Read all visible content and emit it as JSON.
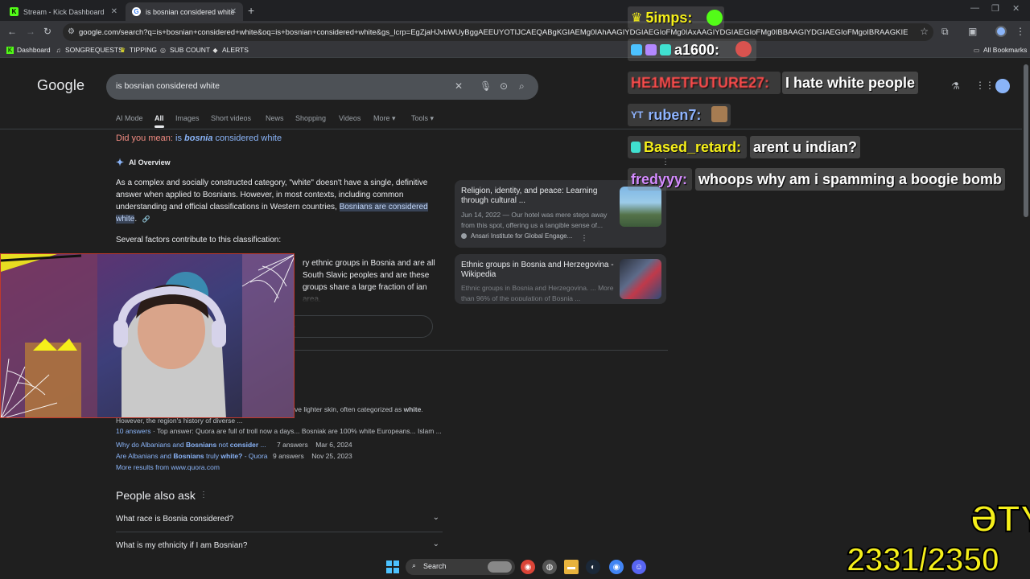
{
  "browser": {
    "tabs": [
      {
        "title": "Stream - Kick Dashboard",
        "favicon": "kick-icon",
        "active": false
      },
      {
        "title": "is bosnian considered white - G",
        "favicon": "google-icon",
        "active": true
      }
    ],
    "new_tab": "+",
    "url": "google.com/search?q=is+bosnian+considered+white&oq=is+bosnian+considered+white&gs_lcrp=EgZjaHJvbWUyBggAEEUYOTIJCAEQABgKGIAEMg0IAhAAGIYDGIAEGIoFMg0IAxAAGIYDGIAEGIoFMg0IBBAAGIYDGIAEGIoFMgoIBRAAGKIEGIkF0gEIMzMyNmowajeoAg..."
  },
  "bookmarks": [
    {
      "label": "Dashboard",
      "icon": "kick-icon"
    },
    {
      "label": "SONGREQUESTS",
      "icon": "music-icon"
    },
    {
      "label": "TIPPING",
      "icon": "tip-icon"
    },
    {
      "label": "SUB COUNT",
      "icon": "sub-icon"
    },
    {
      "label": "ALERTS",
      "icon": "alert-icon"
    }
  ],
  "all_bookmarks": "All Bookmarks",
  "google": {
    "logo": "Google",
    "query": "is bosnian considered white",
    "tabs": [
      "AI Mode",
      "All",
      "Images",
      "Short videos",
      "News",
      "Shopping",
      "Videos",
      "More",
      "Tools"
    ],
    "did_you_mean_label": "Did you mean:",
    "did_you_mean_pre": "is",
    "did_you_mean_bold": "bosnia",
    "did_you_mean_post": "considered white",
    "ai_overview_title": "AI Overview",
    "aio_text": "As a complex and socially constructed category, \"white\" doesn't have a single, definitive answer when applied to Bosnians. However, in most contexts, including common understanding and official classifications in Western countries,",
    "aio_highlight": "Bosnians are considered white",
    "aio_p2": "Several factors contribute to this classification:",
    "aio_p3": "ry ethnic groups in Bosnia and are all South Slavic peoples and are these groups share a large fraction of ian area.",
    "sources": [
      {
        "title": "Religion, identity, and peace: Learning through cultural ...",
        "desc": "Jun 14, 2022 — Our hotel was mere steps away from this spot, offering us a tangible sense of...",
        "site": "Ansari Institute for Global Engage..."
      },
      {
        "title": "Ethnic groups in Bosnia and Herzegovina - Wikipedia",
        "desc": "Ethnic groups in Bosnia and Herzegovina. ... More than 96% of the population of Bosnia ...",
        "site": ""
      }
    ],
    "quora": {
      "snippet1": "ve lighter skin, often categorized as",
      "snippet1_bold": "white",
      "snippet2": "However, the region's history of diverse ...",
      "answers_count": "10 answers",
      "answers_text": " · Top answer: Quora are full of troll now a days... Bosniak are 100% white Europeans... Islam ...",
      "links": [
        {
          "pre": "Why do Albanians and ",
          "bold": "Bosnians",
          "mid": " not ",
          "bold2": "consider",
          "post": " ...",
          "answers": "7 answers",
          "date": "Mar 6, 2024"
        },
        {
          "pre": "Are Albanians and ",
          "bold": "Bosnians",
          "mid": " truly ",
          "bold2": "white?",
          "post": " - Quora",
          "answers": "9 answers",
          "date": "Nov 25, 2023"
        }
      ],
      "more_results": "More results from www.quora.com"
    },
    "paa_title": "People also ask",
    "paa": [
      "What race is Bosnia considered?",
      "What is my ethnicity if I am Bosnian?"
    ]
  },
  "taskbar": {
    "search": "Search"
  },
  "stream": {
    "chat": [
      {
        "user": "5imps:",
        "color": "#f5ef1a",
        "message": ""
      },
      {
        "user": "a1600:",
        "color": "#ffffff",
        "message": ""
      },
      {
        "user": "HE1METFUTURE27:",
        "color": "#ff4d4d",
        "message": "I hate white people"
      },
      {
        "user": "ruben7:",
        "color": "#8fb4ff",
        "message": ""
      },
      {
        "user": "Based_retard:",
        "color": "#f5ef1a",
        "message": "arent u indian?"
      },
      {
        "user": "fredyyy:",
        "color": "#d58cff",
        "message": "whoops why am i spamming a boogie bomb"
      }
    ],
    "counter": "2331/2350",
    "logo_text": "ƏTY"
  },
  "colors": {
    "accent": "#8ab4f8",
    "background": "#1f1f1f",
    "overlay_yellow": "#f5ef1a"
  }
}
